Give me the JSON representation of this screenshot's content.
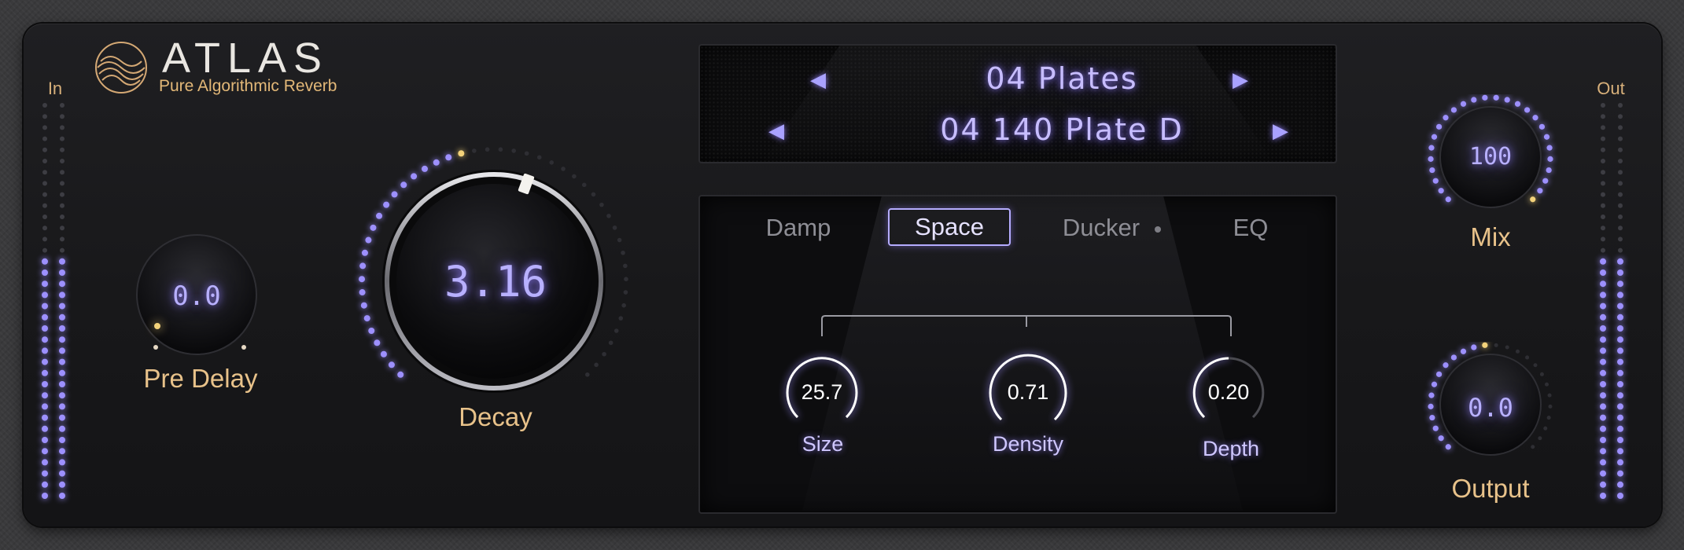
{
  "brand": {
    "name": "ATLAS",
    "subtitle": "Pure Algorithmic Reverb"
  },
  "meters": {
    "in_label": "In",
    "out_label": "Out"
  },
  "knobs": {
    "pre_delay": {
      "label": "Pre Delay",
      "value": "0.0"
    },
    "decay": {
      "label": "Decay",
      "value": "3.16"
    },
    "mix": {
      "label": "Mix",
      "value": "100"
    },
    "output": {
      "label": "Output",
      "value": "0.0"
    }
  },
  "preset": {
    "bank": "04 Plates",
    "name": "04 140 Plate D"
  },
  "tabs": [
    {
      "label": "Damp",
      "active": false
    },
    {
      "label": "Space",
      "active": true
    },
    {
      "label": "Ducker",
      "active": false
    },
    {
      "label": "EQ",
      "active": false
    }
  ],
  "params": {
    "size": {
      "label": "Size",
      "value": "25.7"
    },
    "density": {
      "label": "Density",
      "value": "0.71"
    },
    "depth": {
      "label": "Depth",
      "value": "0.20"
    }
  },
  "colors": {
    "accent": "#8f7dff",
    "label_gold": "#e8c28a",
    "led_on": "#9d90ff",
    "led_off": "#3d3d43",
    "faceplate": "#1b1b1e"
  }
}
